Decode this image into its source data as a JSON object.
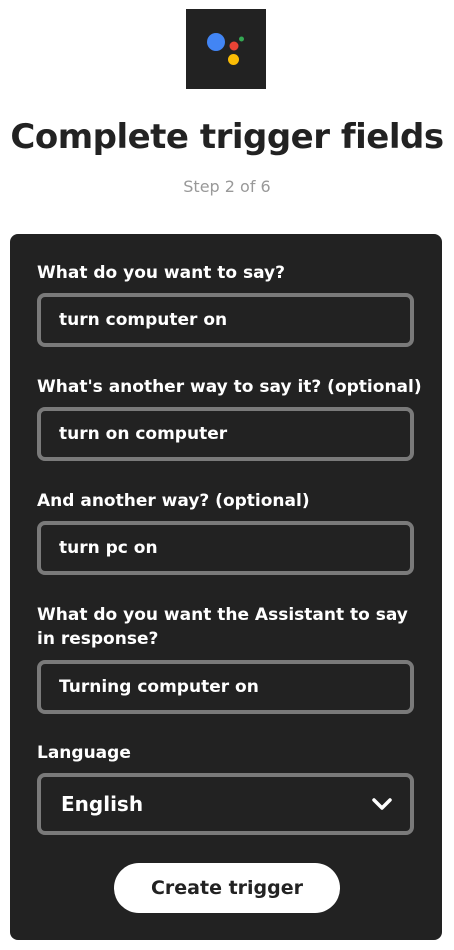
{
  "service_icon": "google-assistant-icon",
  "brand_colors": {
    "blue": "#4285F4",
    "red": "#EA4335",
    "yellow": "#FBBC05",
    "green": "#34A853"
  },
  "header": {
    "title": "Complete trigger fields",
    "step": "Step 2 of 6"
  },
  "form": {
    "fields": [
      {
        "label": "What do you want to say?",
        "value": "turn computer on"
      },
      {
        "label": "What's another way to say it? (optional)",
        "value": "turn on computer"
      },
      {
        "label": "And another way? (optional)",
        "value": "turn pc on"
      },
      {
        "label": "What do you want the Assistant to say in response?",
        "value": "Turning computer on"
      }
    ],
    "language": {
      "label": "Language",
      "selected": "English",
      "icon": "chevron-down-icon"
    },
    "submit_label": "Create trigger"
  }
}
